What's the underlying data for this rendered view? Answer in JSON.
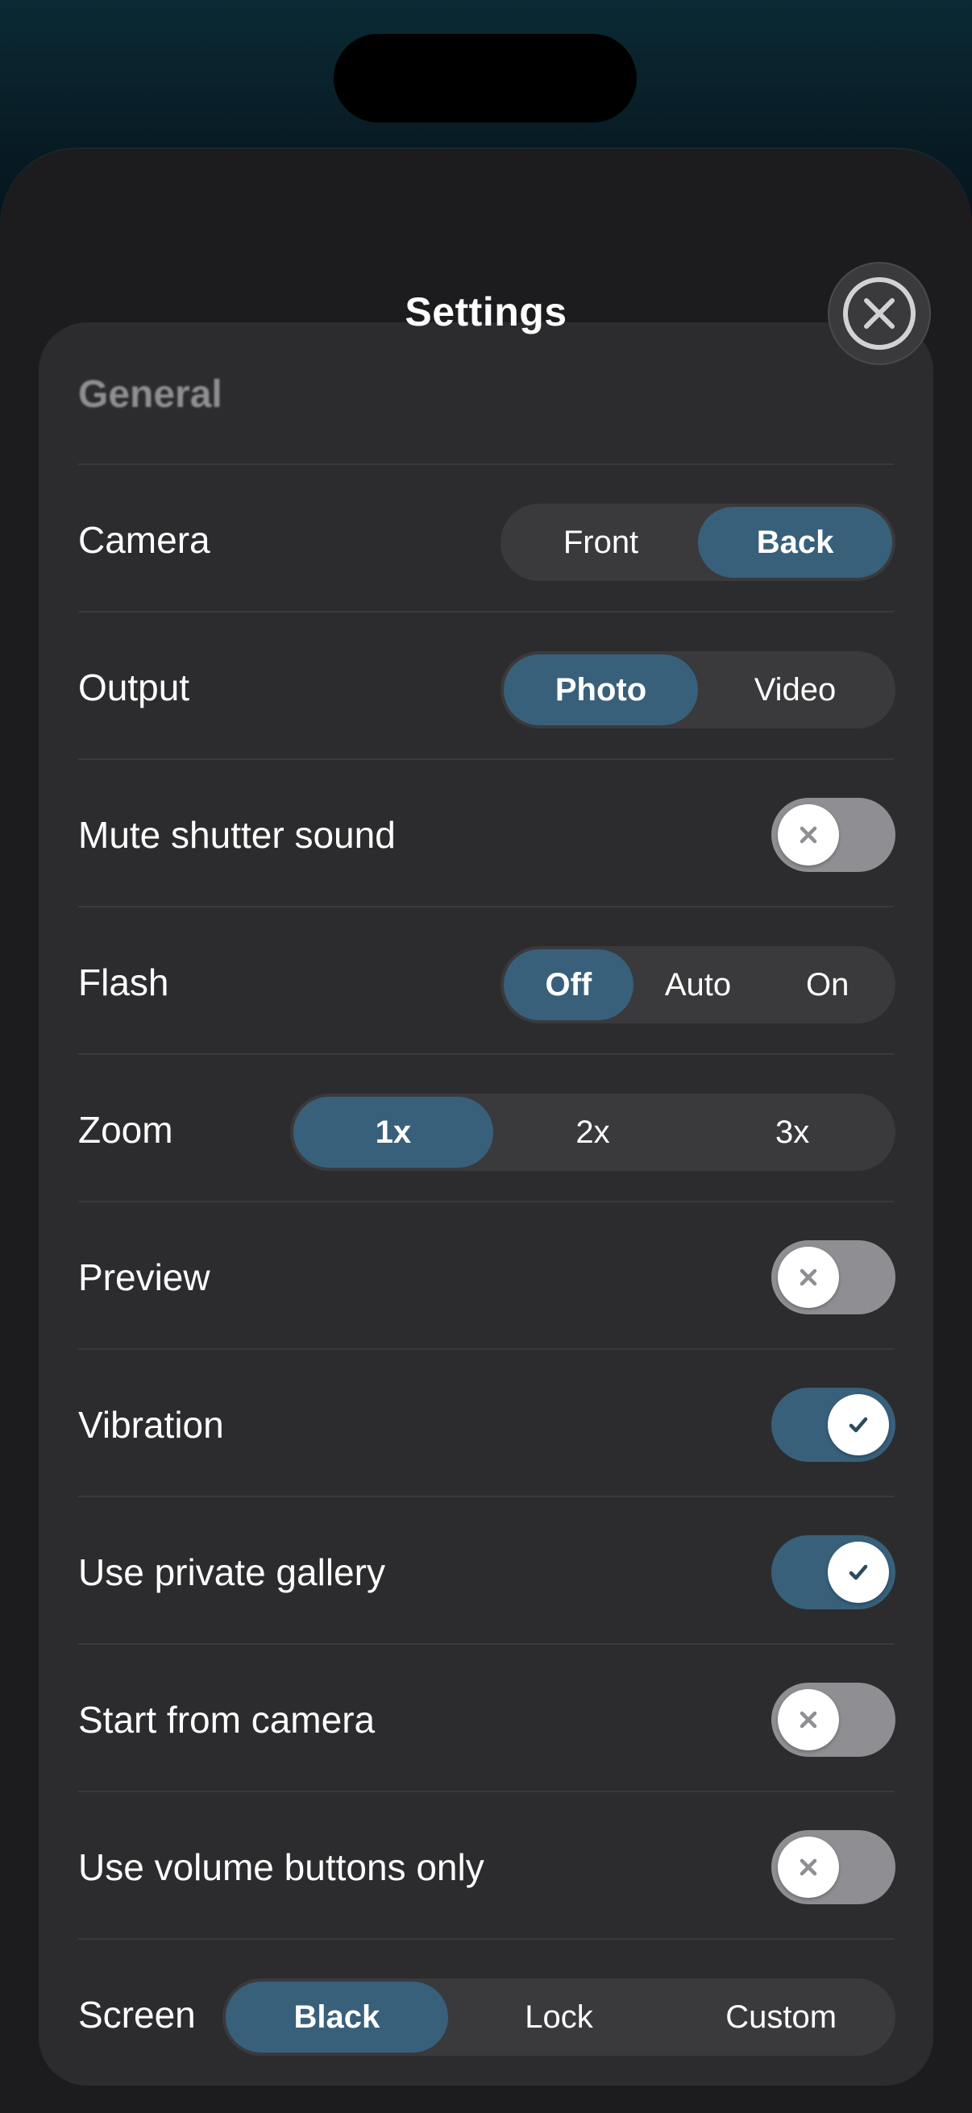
{
  "sheet": {
    "title": "Settings",
    "close_icon": "close-circle-icon"
  },
  "section": {
    "title": "General"
  },
  "rows": {
    "camera": {
      "label": "Camera",
      "options": [
        "Front",
        "Back"
      ],
      "selected": "Back"
    },
    "output": {
      "label": "Output",
      "options": [
        "Photo",
        "Video"
      ],
      "selected": "Photo"
    },
    "mute_shutter": {
      "label": "Mute shutter sound",
      "enabled": false
    },
    "flash": {
      "label": "Flash",
      "options": [
        "Off",
        "Auto",
        "On"
      ],
      "selected": "Off"
    },
    "zoom": {
      "label": "Zoom",
      "options": [
        "1x",
        "2x",
        "3x"
      ],
      "selected": "1x"
    },
    "preview": {
      "label": "Preview",
      "enabled": false
    },
    "vibration": {
      "label": "Vibration",
      "enabled": true
    },
    "private_gallery": {
      "label": "Use private gallery",
      "enabled": true
    },
    "start_camera": {
      "label": "Start from camera",
      "enabled": false
    },
    "volume_buttons": {
      "label": "Use volume buttons only",
      "enabled": false
    },
    "screen": {
      "label": "Screen",
      "options": [
        "Black",
        "Lock",
        "Custom"
      ],
      "selected": "Black"
    }
  },
  "colors": {
    "accent": "#38607b",
    "toggle_off": "#8e8e93",
    "card": "#2c2c2e",
    "sheet": "#1c1c1e"
  }
}
